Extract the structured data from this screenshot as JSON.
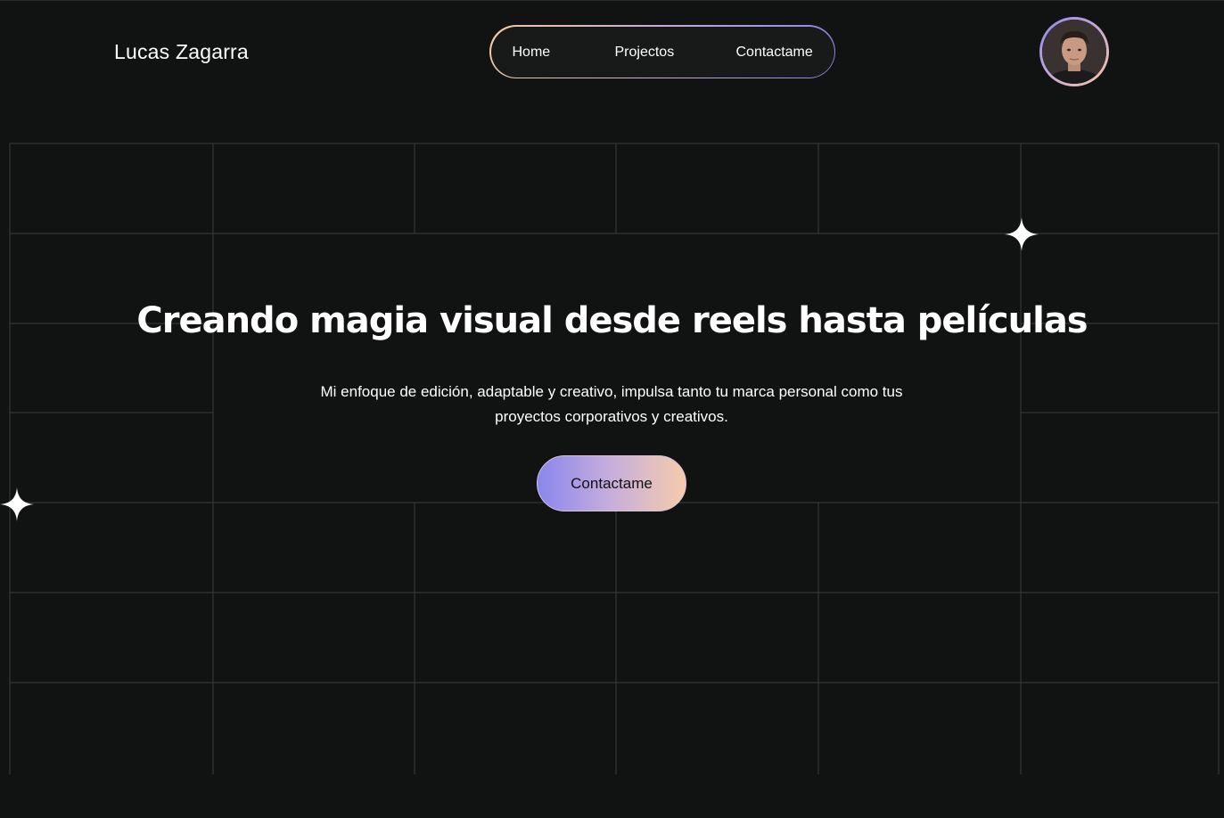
{
  "header": {
    "brand": "Lucas Zagarra",
    "nav": {
      "home": "Home",
      "projects": "Projectos",
      "contact": "Contactame"
    }
  },
  "hero": {
    "title": "Creando magia visual desde reels hasta películas",
    "subtitle": "Mi enfoque de edición, adaptable y creativo, impulsa tanto tu marca personal como tus proyectos corporativos y creativos.",
    "cta": "Contactame"
  },
  "colors": {
    "background": "#111212",
    "grid_line": "#3a3c3c",
    "gradient_start": "#8a86ee",
    "gradient_end": "#f6ccab"
  },
  "icons": {
    "sparkle": "four-point-star-icon",
    "avatar": "profile-photo"
  }
}
